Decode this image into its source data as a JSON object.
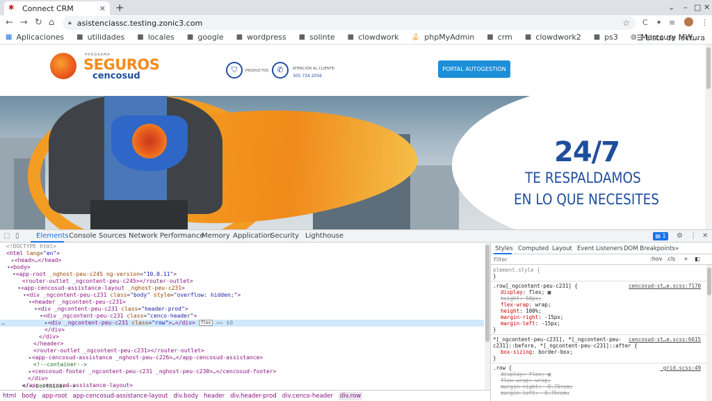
{
  "browser": {
    "tab_title": "Connect CRM",
    "url": "asistenciassc.testing.zonic3.com"
  },
  "bookmarks": {
    "items": [
      "Aplicaciones",
      "utilidades",
      "locales",
      "google",
      "wordpress",
      "solinte",
      "clowdwork",
      "phpMyAdmin",
      "crm",
      "clowdwork2",
      "ps3",
      "Merccury MW..."
    ],
    "reading_list": "Lista de lectura"
  },
  "site": {
    "logo_programa": "PROGRAMA",
    "logo_seguros": "SEGUROS",
    "logo_cencosud": "cencosud",
    "productos": "PRODUCTOS",
    "atencion": "ATENCIÓN AL CLIENTE:",
    "phone": "305 734 2056",
    "portal_button": "PORTAL AUTOGESTIÓN",
    "hero_big": "24/7",
    "hero_line1": "TE RESPALDAMOS",
    "hero_line2": "EN LO QUE NECESITES"
  },
  "devtools": {
    "tabs": [
      "Elements",
      "Console",
      "Sources",
      "Network",
      "Performance",
      "Memory",
      "Application",
      "Security",
      "Lighthouse"
    ],
    "issues_count": "1",
    "dom": {
      "doctype": "<!DOCTYPE html>",
      "html_open": "html",
      "lang_attr": "lang",
      "lang_val": "\"en\"",
      "head": "<head>…</head>",
      "body": "<body>",
      "approot": "app-root",
      "approot_attrs": "_nghost-peu-c245 ng-version",
      "approot_ver": "\"10.0.11\"",
      "router1": "<router-outlet _ngcontent-peu-c245></router-outlet>",
      "layout_tag": "app-cencosud-assistance-layout",
      "layout_attr": "_nghost-peu-c231",
      "div_body": "div _ngcontent-peu-c231",
      "div_body_class": "class",
      "div_body_class_v": "\"body\"",
      "div_body_style": "style",
      "div_body_style_v": "\"overflow: hidden;\"",
      "header": "header _ngcontent-peu-c231",
      "header_prod": "div _ngcontent-peu-c231",
      "header_prod_class": "class",
      "header_prod_v": "\"header-prod\"",
      "cenco_header": "div _ngcontent-peu-c231",
      "cenco_header_class": "class",
      "cenco_header_v": "\"cenco-header\"",
      "row_div": "div _ngcontent-peu-c231",
      "row_class": "class",
      "row_v": "\"row\"",
      "row_tail": "…</div>",
      "flex_badge": "flex",
      "eq_s0": "== $0",
      "close_div1": "</div>",
      "close_div2": "</div>",
      "close_header": "</header>",
      "router2": "<router-outlet _ngcontent-peu-c231></router-outlet>",
      "assist": "<app-cencosud-assistance _nghost-peu-c226>…</app-cencosud-assistance>",
      "comment1": "<!--container-->",
      "footer": "<cencosud-footer _ngcontent-peu-c231 _nghost-peu-c230>…</cencosud-footer>",
      "close_div3": "</div>",
      "close_layout": "</app-cencosud-assistance-layout>",
      "comment2": "<!--container-->"
    },
    "breadcrumbs": [
      "html",
      "body",
      "app-root",
      "app-cencosud-assistance-layout",
      "div.body",
      "header",
      "div.header-prod",
      "div.cenco-header",
      "div.row"
    ],
    "styles": {
      "tabs": [
        "Styles",
        "Computed",
        "Layout",
        "Event Listeners",
        "DOM Breakpoints"
      ],
      "filter_placeholder": "Filter",
      "hov": ":hov",
      "cls": ".cls",
      "element_style": "element.style {",
      "close_brace": "}",
      "rule1_selector": ".row[_ngcontent-peu-c231] {",
      "rule1_src": "cencosud-st…e.scss:7170",
      "rule1_props": [
        {
          "n": "display",
          "v": "flex;",
          "s": false
        },
        {
          "n": "height",
          "v": "50px;",
          "s": true
        },
        {
          "n": "flex-wrap",
          "v": "wrap;",
          "s": false
        },
        {
          "n": "height",
          "v": "100%;",
          "s": false
        },
        {
          "n": "margin-right",
          "v": "-15px;",
          "s": false
        },
        {
          "n": "margin-left",
          "v": "-15px;",
          "s": false
        }
      ],
      "rule2_sel1": "*[_ngcontent-peu-c231], *[_ngcontent-peu-",
      "rule2_sel2": "c231]::before, *[_ngcontent-peu-c231]::after {",
      "rule2_src": "cencosud-st…e.scss:6615",
      "rule2_prop_n": "box-sizing",
      "rule2_prop_v": "border-box;",
      "rule3_selector": ".row {",
      "rule3_src": "_grid.scss:49",
      "rule3_props": [
        {
          "n": "display",
          "v": "flex;"
        },
        {
          "n": "flex-wrap",
          "v": "wrap;"
        },
        {
          "n": "margin-right",
          "v": "-0.75rem;"
        },
        {
          "n": "margin-left",
          "v": "-0.75rem;"
        }
      ]
    }
  },
  "colors": {
    "brand_orange": "#f28b1e",
    "brand_blue": "#1f4e9c",
    "portal_button": "#1c8fd8",
    "devtools_accent": "#1a73e8"
  }
}
